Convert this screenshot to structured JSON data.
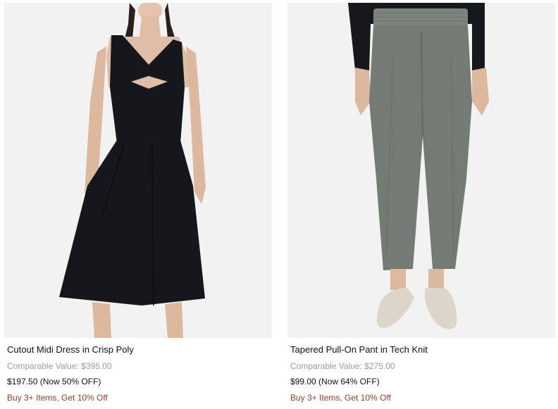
{
  "products": [
    {
      "name": "Cutout Midi Dress in Crisp Poly",
      "comparable": "Comparable Value: $395.00",
      "price": "$197.50 (Now 50% OFF)",
      "promo": "Buy 3+ Items, Get 10% Off",
      "image_icon": "dress-photo",
      "color": "#15171c"
    },
    {
      "name": "Tapered Pull-On Pant in Tech Knit",
      "comparable": "Comparable Value: $275.00",
      "price": "$99.00 (Now 64% OFF)",
      "promo": "Buy 3+ Items, Get 10% Off",
      "image_icon": "pants-photo",
      "color": "#737b74"
    }
  ],
  "colors": {
    "promo": "#9a3b2a",
    "muted": "#9a9a9a",
    "image_bg": "#f2f2f2"
  }
}
